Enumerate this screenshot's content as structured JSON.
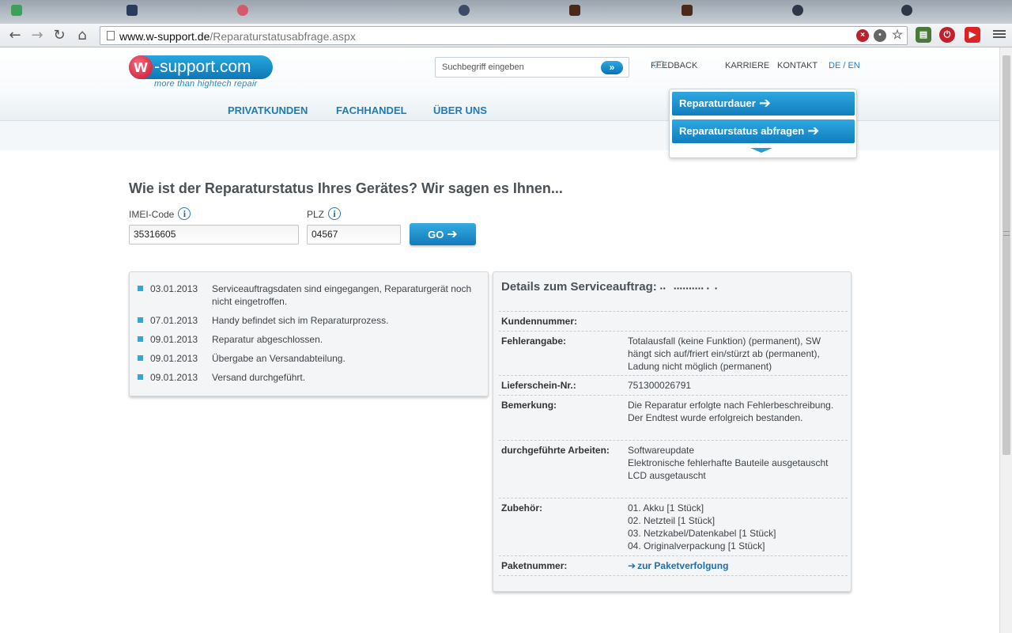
{
  "browser": {
    "url_host": "www.w-support.de",
    "url_path": "/Reparaturstatusabfrage.aspx"
  },
  "site": {
    "logo_letter": "w",
    "logo_name": "-support.com",
    "logo_tagline": "more than hightech repair",
    "search_placeholder": "Suchbegriff eingeben",
    "search_go": "»",
    "toplinks": {
      "feedback": "FEEDBACK",
      "karriere": "KARRIERE",
      "kontakt": "KONTAKT",
      "lang": "DE / EN"
    },
    "nav": {
      "privatkunden": "PRIVATKUNDEN",
      "fachhandel": "FACHHANDEL",
      "ueber_uns": "ÜBER UNS"
    },
    "flyout": {
      "dauer": "Reparaturdauer",
      "status": "Reparaturstatus abfragen"
    }
  },
  "form": {
    "heading": "Wie ist der Reparaturstatus Ihres Gerätes? Wir sagen es Ihnen...",
    "imei_label": "IMEI-Code",
    "imei_value": "35316605",
    "plz_label": "PLZ",
    "plz_value": "04567",
    "go_label": "GO"
  },
  "timeline": [
    {
      "date": "03.01.2013",
      "text": "Serviceauftragsdaten sind eingegangen, Reparaturgerät noch nicht eingetroffen."
    },
    {
      "date": "07.01.2013",
      "text": "Handy befindet sich im Reparaturprozess."
    },
    {
      "date": "09.01.2013",
      "text": "Reparatur abgeschlossen."
    },
    {
      "date": "09.01.2013",
      "text": "Übergabe an Versandabteilung."
    },
    {
      "date": "09.01.2013",
      "text": "Versand durchgeführt."
    }
  ],
  "details": {
    "title": "Details zum Serviceauftrag:",
    "rows": [
      {
        "label": "Kundennummer:",
        "value": ""
      },
      {
        "label": "Fehlerangabe:",
        "value": "Totalausfall (keine Funktion) (permanent), SW hängt sich auf/friert ein/stürzt ab (permanent), Ladung nicht möglich (permanent)"
      },
      {
        "label": "Lieferschein-Nr.:",
        "value": "751300026791"
      },
      {
        "label": "Bemerkung:",
        "value": "Die Reparatur erfolgte nach Fehlerbeschreibung. Der Endtest wurde erfolgreich bestanden."
      },
      {
        "label": "durchgeführte Arbeiten:",
        "lines": [
          "Softwareupdate",
          "Elektronische fehlerhafte Bauteile ausgetauscht",
          "LCD ausgetauscht"
        ]
      },
      {
        "label": "Zubehör:",
        "lines": [
          "01. Akku [1 Stück]",
          "02. Netzteil [1 Stück]",
          "03. Netzkabel/Datenkabel [1 Stück]",
          "04. Originalverpackung [1 Stück]"
        ]
      },
      {
        "label": "Paketnummer:",
        "link": "zur Paketverfolgung"
      }
    ]
  }
}
